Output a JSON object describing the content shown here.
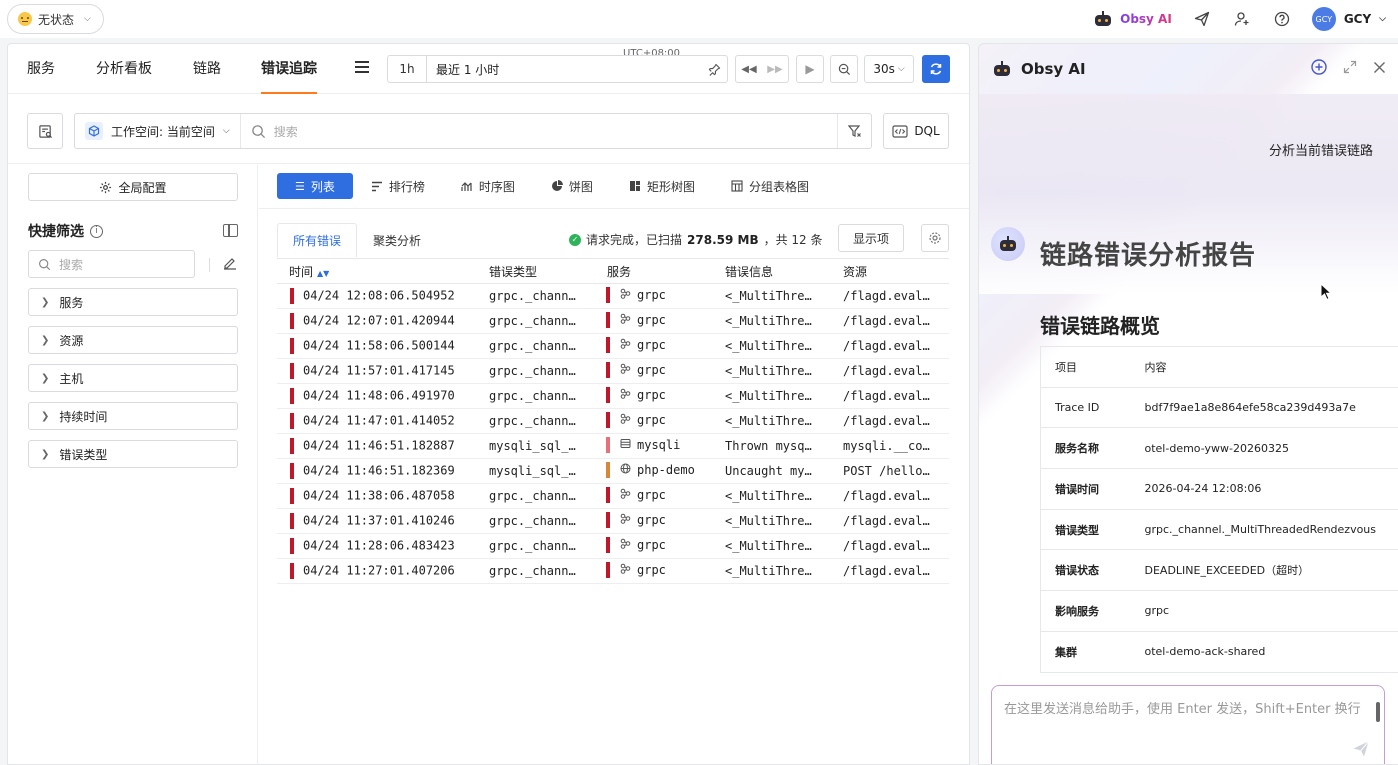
{
  "topbar": {
    "status": "无状态",
    "brand": "Obsy AI",
    "user": "GCY",
    "avatar_text": "GCY"
  },
  "nav": {
    "tabs": [
      "服务",
      "分析看板",
      "链路",
      "错误追踪"
    ],
    "active": "错误追踪"
  },
  "time": {
    "timezone": "UTC+08:00",
    "relative": "1h",
    "range_label": "最近 1 小时",
    "refresh_interval": "30s"
  },
  "filter": {
    "workspace": "工作空间: 当前空间",
    "search_placeholder": "搜索",
    "dql_label": "DQL"
  },
  "sidebar": {
    "global_config": "全局配置",
    "quick_filter_title": "快捷筛选",
    "search_placeholder": "搜索",
    "facets": [
      "服务",
      "资源",
      "主机",
      "持续时间",
      "错误类型"
    ]
  },
  "view_tabs": [
    "列表",
    "排行榜",
    "时序图",
    "饼图",
    "矩形树图",
    "分组表格图"
  ],
  "sub_tabs": [
    "所有错误",
    "聚类分析"
  ],
  "request_status": {
    "prefix": "请求完成，已扫描",
    "size": "278.59 MB",
    "suffix": "，共 12 条"
  },
  "show_columns_label": "显示项",
  "table": {
    "columns": [
      "时间",
      "错误类型",
      "服务",
      "错误信息",
      "资源"
    ],
    "rows": [
      {
        "time": "04/24 12:08:06.504952",
        "type": "grpc._chann…",
        "service": "grpc",
        "svc_icon": "grpc",
        "svc_color": "#c0182a",
        "message": "<_MultiThre…",
        "resource": "/flagd.eval…"
      },
      {
        "time": "04/24 12:07:01.420944",
        "type": "grpc._chann…",
        "service": "grpc",
        "svc_icon": "grpc",
        "svc_color": "#c0182a",
        "message": "<_MultiThre…",
        "resource": "/flagd.eval…"
      },
      {
        "time": "04/24 11:58:06.500144",
        "type": "grpc._chann…",
        "service": "grpc",
        "svc_icon": "grpc",
        "svc_color": "#c0182a",
        "message": "<_MultiThre…",
        "resource": "/flagd.eval…"
      },
      {
        "time": "04/24 11:57:01.417145",
        "type": "grpc._chann…",
        "service": "grpc",
        "svc_icon": "grpc",
        "svc_color": "#c0182a",
        "message": "<_MultiThre…",
        "resource": "/flagd.eval…"
      },
      {
        "time": "04/24 11:48:06.491970",
        "type": "grpc._chann…",
        "service": "grpc",
        "svc_icon": "grpc",
        "svc_color": "#c0182a",
        "message": "<_MultiThre…",
        "resource": "/flagd.eval…"
      },
      {
        "time": "04/24 11:47:01.414052",
        "type": "grpc._chann…",
        "service": "grpc",
        "svc_icon": "grpc",
        "svc_color": "#c0182a",
        "message": "<_MultiThre…",
        "resource": "/flagd.eval…"
      },
      {
        "time": "04/24 11:46:51.182887",
        "type": "mysqli_sql_…",
        "service": "mysqli",
        "svc_icon": "db",
        "svc_color": "#e8707a",
        "message": "Thrown mysq…",
        "resource": "mysqli.__co…"
      },
      {
        "time": "04/24 11:46:51.182369",
        "type": "mysqli_sql_…",
        "service": "php-demo",
        "svc_icon": "web",
        "svc_color": "#d9863a",
        "message": "Uncaught my…",
        "resource": "POST /hello…"
      },
      {
        "time": "04/24 11:38:06.487058",
        "type": "grpc._chann…",
        "service": "grpc",
        "svc_icon": "grpc",
        "svc_color": "#c0182a",
        "message": "<_MultiThre…",
        "resource": "/flagd.eval…"
      },
      {
        "time": "04/24 11:37:01.410246",
        "type": "grpc._chann…",
        "service": "grpc",
        "svc_icon": "grpc",
        "svc_color": "#c0182a",
        "message": "<_MultiThre…",
        "resource": "/flagd.eval…"
      },
      {
        "time": "04/24 11:28:06.483423",
        "type": "grpc._chann…",
        "service": "grpc",
        "svc_icon": "grpc",
        "svc_color": "#c0182a",
        "message": "<_MultiThre…",
        "resource": "/flagd.eval…"
      },
      {
        "time": "04/24 11:27:01.407206",
        "type": "grpc._chann…",
        "service": "grpc",
        "svc_icon": "grpc",
        "svc_color": "#c0182a",
        "message": "<_MultiThre…",
        "resource": "/flagd.eval…"
      }
    ]
  },
  "ai": {
    "title": "Obsy AI",
    "user_message": "分析当前错误链路",
    "report_title": "链路错误分析报告",
    "section_title": "错误链路概览",
    "kv_header": [
      "项目",
      "内容"
    ],
    "kv": [
      [
        "Trace ID",
        "bdf7f9ae1a8e864efe58ca239d493a7e"
      ],
      [
        "服务名称",
        "otel-demo-yww-20260325"
      ],
      [
        "错误时间",
        "2026-04-24 12:08:06"
      ],
      [
        "错误类型",
        "grpc._channel._MultiThreadedRendezvous"
      ],
      [
        "错误状态",
        "DEADLINE_EXCEEDED（超时）"
      ],
      [
        "影响服务",
        "grpc"
      ],
      [
        "集群",
        "otel-demo-ack-shared"
      ]
    ],
    "input_placeholder": "在这里发送消息给助手，使用 Enter 发送，Shift+Enter 换行"
  },
  "colors": {
    "primary": "#2f6ee0",
    "active_tab_underline": "#ff7a1a",
    "error_mark": "#c0182a",
    "success": "#2eb35a"
  }
}
